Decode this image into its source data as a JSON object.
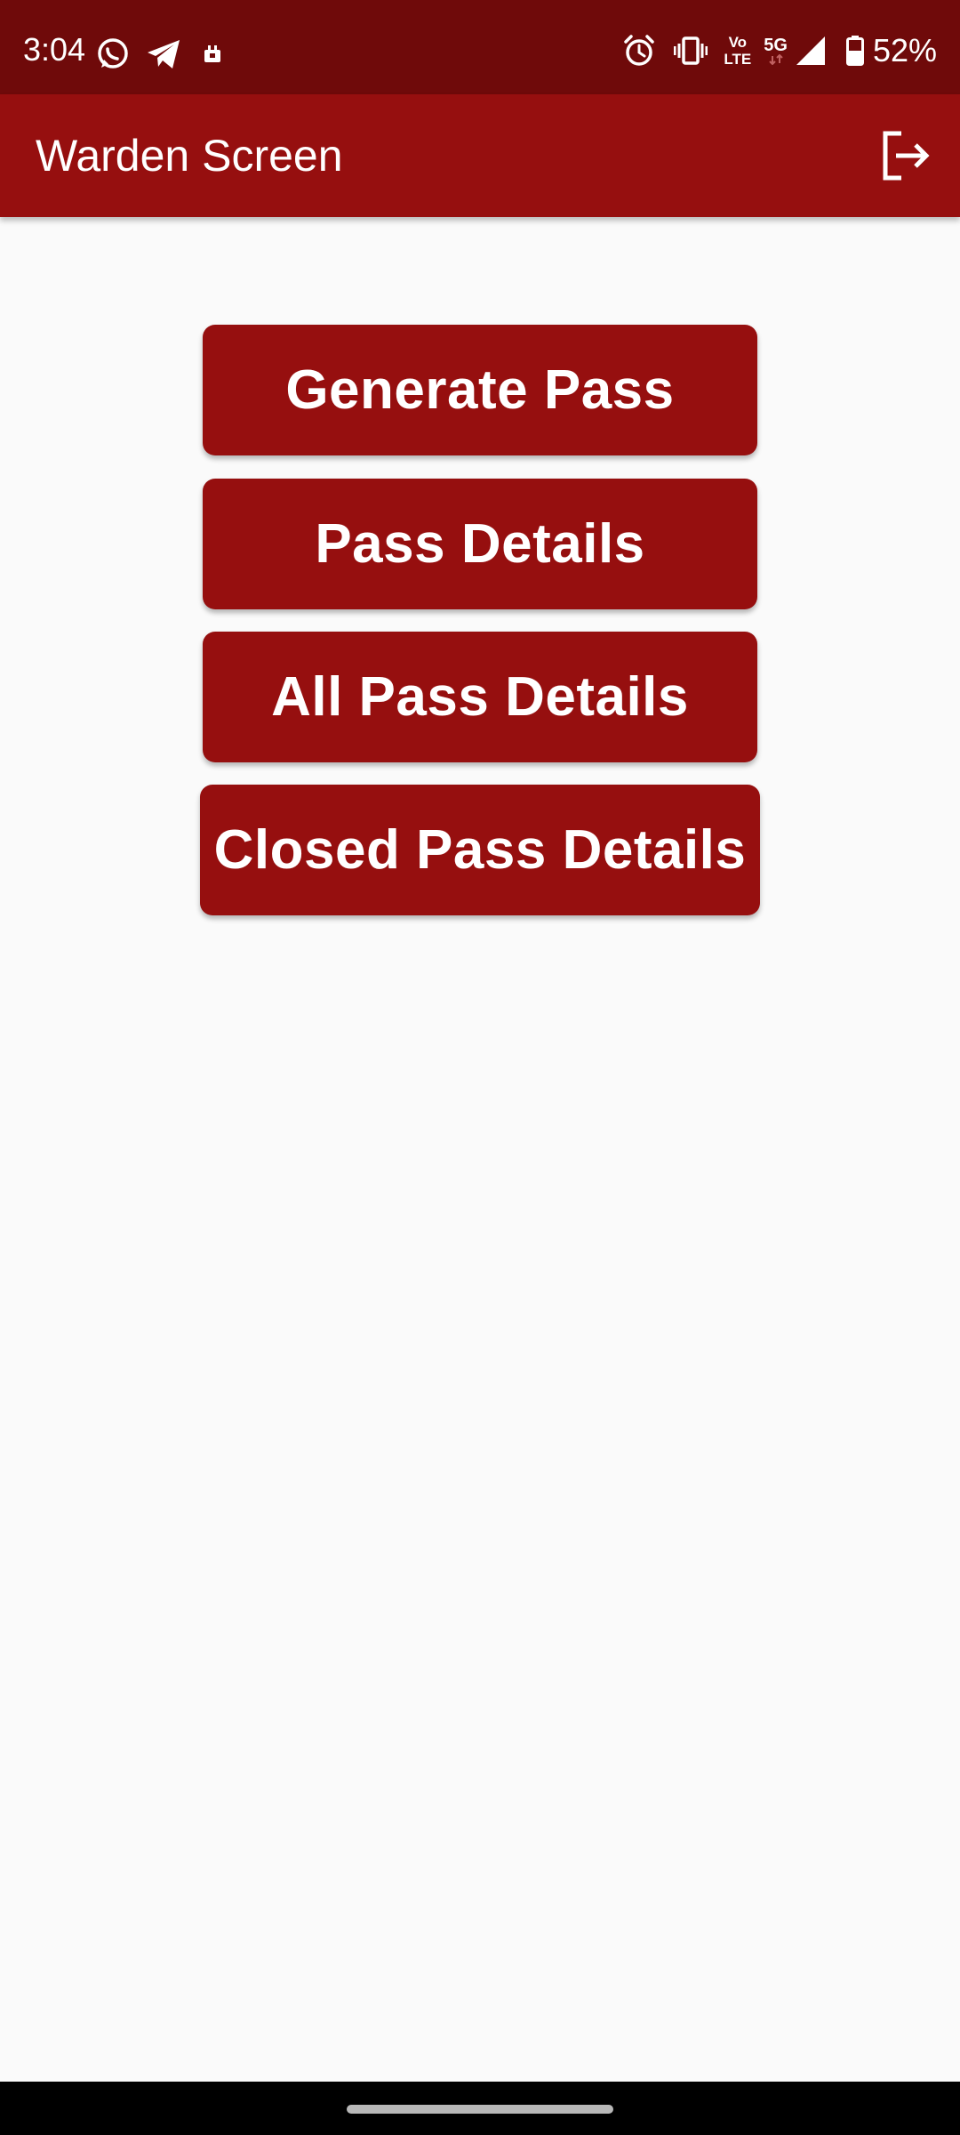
{
  "status_bar": {
    "time": "3:04",
    "left_icons": [
      "whatsapp-icon",
      "telegram-icon",
      "app-notification-icon"
    ],
    "right_icons": [
      "alarm-icon",
      "vibrate-icon",
      "volte-icon",
      "5g-icon",
      "signal-icon",
      "battery-icon"
    ],
    "volte_label_top": "Vo",
    "volte_label_bottom": "LTE",
    "network_label": "5G",
    "battery": "52%"
  },
  "app_bar": {
    "title": "Warden Screen",
    "action_icon": "logout-icon"
  },
  "buttons": {
    "generate_pass": "Generate Pass",
    "pass_details": "Pass Details",
    "all_pass_details": "All Pass Details",
    "closed_pass_details": "Closed Pass Details"
  },
  "colors": {
    "status_bar": "#6f0a0a",
    "primary": "#960f0f",
    "background": "#fafafa",
    "on_primary": "#ffffff"
  }
}
